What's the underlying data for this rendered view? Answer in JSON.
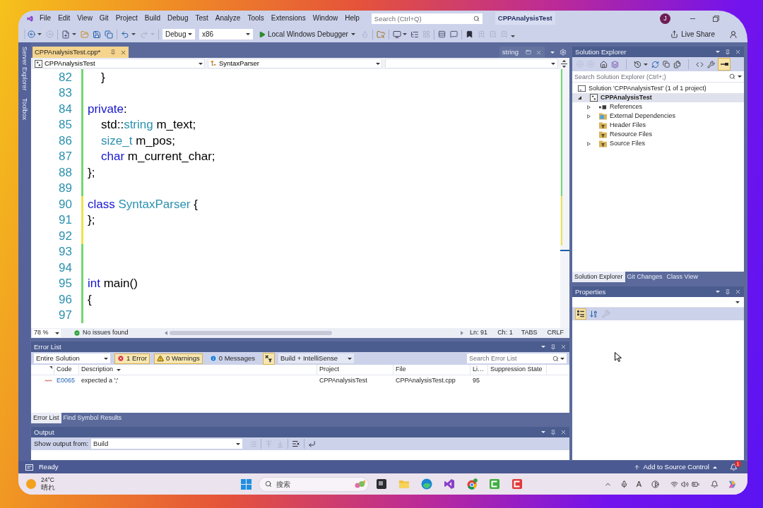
{
  "menu": [
    "File",
    "Edit",
    "View",
    "Git",
    "Project",
    "Build",
    "Debug",
    "Test",
    "Analyze",
    "Tools",
    "Extensions",
    "Window",
    "Help"
  ],
  "search": {
    "placeholder": "Search (Ctrl+Q)"
  },
  "window_title": "CPPAnalysisTest",
  "account": {
    "initial": "J"
  },
  "toolbar": {
    "configuration": "Debug",
    "platform": "x86",
    "debugger": "Local Windows Debugger",
    "live_share": "Live Share"
  },
  "side_tabs": [
    "Server Explorer",
    "Toolbox"
  ],
  "editor": {
    "tabs": [
      {
        "label": "CPPAnalysisTest.cpp*",
        "kind": "document",
        "selected": true
      },
      {
        "label": "string",
        "kind": "preview",
        "selected": false
      }
    ],
    "navigation": {
      "project": "CPPAnalysisTest",
      "scope": "SyntaxParser"
    },
    "lines": [
      {
        "number": "82",
        "saved": true,
        "indented": true,
        "tokens": [
          {
            "kind": "plain",
            "text": "}"
          }
        ]
      },
      {
        "number": "83",
        "saved": true
      },
      {
        "number": "84",
        "saved": true,
        "indented": false,
        "tokens": [
          {
            "kind": "keyword",
            "text": "private"
          },
          {
            "kind": "plain",
            "text": ":"
          }
        ]
      },
      {
        "number": "85",
        "saved": true,
        "indented": true,
        "tokens": [
          {
            "kind": "plain",
            "text": "std::"
          },
          {
            "kind": "type",
            "text": "string"
          },
          {
            "kind": "plain",
            "text": " m_text;"
          }
        ]
      },
      {
        "number": "86",
        "saved": true,
        "indented": true,
        "tokens": [
          {
            "kind": "type",
            "text": "size_t"
          },
          {
            "kind": "plain",
            "text": " m_pos;"
          }
        ]
      },
      {
        "number": "87",
        "saved": true,
        "indented": true,
        "tokens": [
          {
            "kind": "keyword",
            "text": "char"
          },
          {
            "kind": "plain",
            "text": " m_current_char;"
          }
        ]
      },
      {
        "number": "88",
        "saved": true,
        "indented": false,
        "tokens": [
          {
            "kind": "plain",
            "text": "};"
          }
        ]
      },
      {
        "number": "89",
        "saved": true
      },
      {
        "number": "90",
        "saved": false,
        "indented": false,
        "tokens": [
          {
            "kind": "keyword",
            "text": "class "
          },
          {
            "kind": "type",
            "text": "SyntaxParser"
          },
          {
            "kind": "plain",
            "text": " {"
          }
        ]
      },
      {
        "number": "91",
        "saved": false,
        "indented": false,
        "tokens": [
          {
            "kind": "plain",
            "text": "};"
          }
        ]
      },
      {
        "number": "92",
        "saved": false
      },
      {
        "number": "93",
        "saved": true
      },
      {
        "number": "94",
        "saved": true
      },
      {
        "number": "95",
        "saved": true,
        "indented": false,
        "tokens": [
          {
            "kind": "keyword",
            "text": "int"
          },
          {
            "kind": "plain",
            "text": " main()"
          }
        ]
      },
      {
        "number": "96",
        "saved": true,
        "indented": false,
        "tokens": [
          {
            "kind": "plain",
            "text": "{"
          }
        ]
      },
      {
        "number": "97",
        "saved": true
      }
    ],
    "zoom": "78 %",
    "issues": "No issues found",
    "caret_line": "Ln: 91",
    "caret_column": "Ch: 1",
    "indentation": "TABS",
    "line_endings": "CRLF"
  },
  "error_list": {
    "title": "Error List",
    "scope": "Entire Solution",
    "filters": [
      {
        "kind": "error",
        "label": "1 Error",
        "selected": true
      },
      {
        "kind": "warning",
        "label": "0 Warnings",
        "selected": true
      },
      {
        "kind": "message",
        "label": "0 Messages",
        "selected": false
      }
    ],
    "document_filter": {
      "selected": true
    },
    "source": "Build + IntelliSense",
    "search": {
      "placeholder": "Search Error List"
    },
    "columns": [
      "Code",
      "Description",
      "Project",
      "File",
      "Li…",
      "Suppression State"
    ],
    "rows": [
      {
        "kind": "error",
        "code": "E0065",
        "description": "expected a ';'",
        "project": "CPPAnalysisTest",
        "file": "CPPAnalysisTest.cpp",
        "line": "95"
      }
    ],
    "tabs": [
      {
        "label": "Error List",
        "selected": true
      },
      {
        "label": "Find Symbol Results",
        "selected": false
      }
    ]
  },
  "output": {
    "title": "Output",
    "label": "Show output from:",
    "source": "Build"
  },
  "solution_explorer": {
    "title": "Solution Explorer",
    "preview_toggle": {
      "selected": true
    },
    "search": {
      "placeholder": "Search Solution Explorer (Ctrl+;)"
    },
    "tree": [
      {
        "label": "Solution 'CPPAnalysisTest' (1 of 1 project)",
        "kind": "solution",
        "selected": false,
        "children": [
          {
            "label": "CPPAnalysisTest",
            "kind": "project",
            "expanded": true,
            "selected": true,
            "children": [
              {
                "label": "References",
                "kind": "references",
                "expanded": false,
                "selected": false
              },
              {
                "label": "External Dependencies",
                "kind": "dependencies",
                "expanded": false,
                "selected": false
              },
              {
                "label": "Header Files",
                "kind": "filter",
                "selected": false
              },
              {
                "label": "Resource Files",
                "kind": "filter",
                "selected": false
              },
              {
                "label": "Source Files",
                "kind": "filter",
                "expanded": false,
                "selected": false
              }
            ]
          }
        ]
      }
    ],
    "tabs": [
      {
        "label": "Solution Explorer",
        "selected": true
      },
      {
        "label": "Git Changes",
        "selected": false
      },
      {
        "label": "Class View",
        "selected": false
      }
    ]
  },
  "properties": {
    "title": "Properties",
    "view_buttons": [
      {
        "kind": "categorized",
        "selected": true
      },
      {
        "kind": "alphabetical",
        "selected": false
      },
      {
        "kind": "property-pages",
        "selected": false
      }
    ]
  },
  "status_bar": {
    "text": "Ready",
    "source_control": "Add to Source Control",
    "notification_count": "1"
  },
  "taskbar": {
    "weather": {
      "temperature": "24°C",
      "condition": "晴れ"
    },
    "search": {
      "placeholder": "搜索"
    },
    "ime": "A"
  }
}
